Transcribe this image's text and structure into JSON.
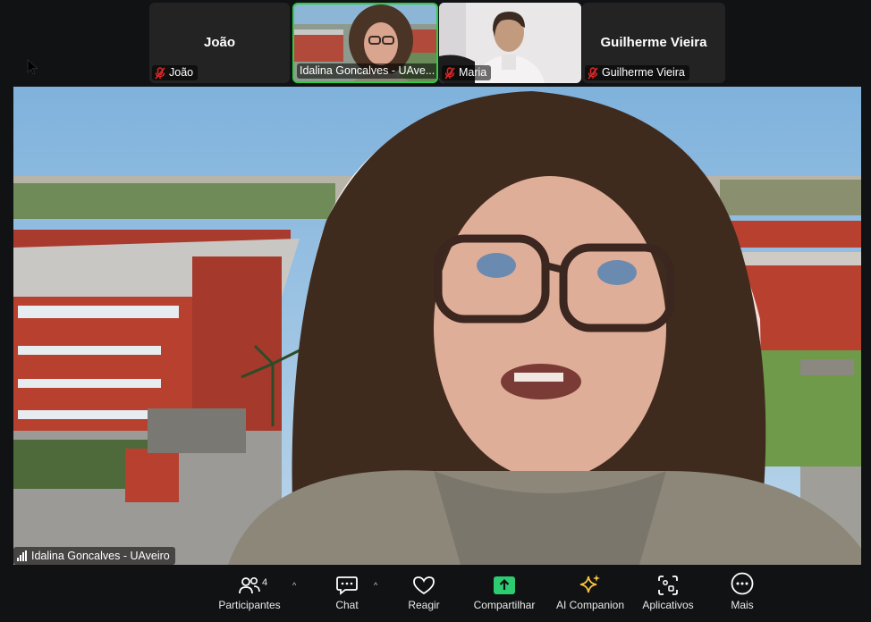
{
  "participants_strip": [
    {
      "big_name": "João",
      "label": "João",
      "muted": true,
      "has_video": false
    },
    {
      "big_name": "",
      "label": "Idalina Goncalves - UAve...",
      "muted": false,
      "has_video": true,
      "active": true
    },
    {
      "big_name": "",
      "label": "Maria",
      "muted": true,
      "has_video": true
    },
    {
      "big_name": "Guilherme Vieira",
      "label": "Guilherme Vieira",
      "muted": true,
      "has_video": false
    }
  ],
  "main_speaker": {
    "label": "Idalina Goncalves - UAveiro"
  },
  "toolbar": {
    "participants_label": "Participantes",
    "participants_count": "4",
    "chat_label": "Chat",
    "react_label": "Reagir",
    "share_label": "Compartilhar",
    "ai_label": "AI Companion",
    "apps_label": "Aplicativos",
    "more_label": "Mais"
  },
  "colors": {
    "share_green": "#2ecc71",
    "mute_red": "#e02828",
    "active_border": "#2ecc40"
  }
}
